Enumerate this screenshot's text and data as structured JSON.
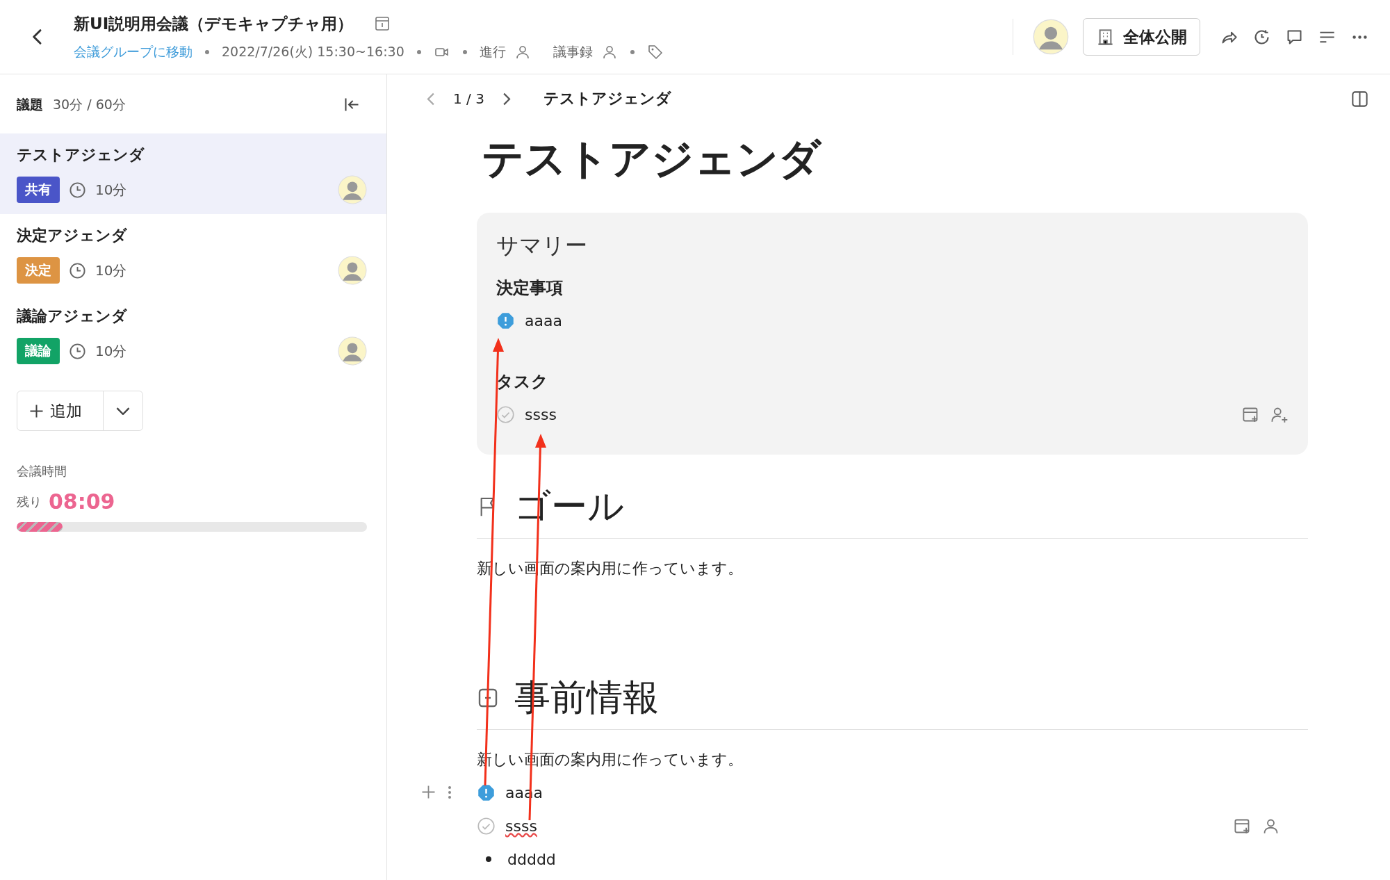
{
  "header": {
    "title": "新UI説明用会議（デモキャプチャ用）",
    "group_link": "会議グループに移動",
    "datetime": "2022/7/26(火) 15:30~16:30",
    "facilitator_label": "進行",
    "minutes_label": "議事録",
    "visibility_button": "全体公開"
  },
  "sidebar": {
    "title": "議題",
    "time_summary": "30分 / 60分",
    "agendas": [
      {
        "title": "テストアジェンダ",
        "tag": "共有",
        "color": "#4a55c8",
        "duration": "10分",
        "selected": true
      },
      {
        "title": "決定アジェンダ",
        "tag": "決定",
        "color": "#dd9443",
        "duration": "10分",
        "selected": false
      },
      {
        "title": "議論アジェンダ",
        "tag": "議論",
        "color": "#12a366",
        "duration": "10分",
        "selected": false
      }
    ],
    "add_button": "追加",
    "meeting_time_label": "会議時間",
    "remaining_label": "残り",
    "remaining_time": "08:09",
    "progress": {
      "level": 0.13
    }
  },
  "content": {
    "page": "1 / 3",
    "breadcrumb": "テストアジェンダ",
    "title": "テストアジェンダ",
    "summary": {
      "title": "サマリー",
      "decisions_heading": "決定事項",
      "decisions": [
        "aaaa"
      ],
      "tasks_heading": "タスク",
      "tasks": [
        "ssss"
      ]
    },
    "sections": [
      {
        "kind": "goal",
        "heading": "ゴール",
        "body": "新しい画面の案内用に作っています。"
      },
      {
        "kind": "info",
        "heading": "事前情報",
        "body": "新しい画面の案内用に作っています。",
        "items": [
          {
            "kind": "decision",
            "text": "aaaa"
          },
          {
            "kind": "task",
            "text": "ssss"
          },
          {
            "kind": "bullet",
            "text": "ddddd"
          }
        ]
      }
    ]
  }
}
